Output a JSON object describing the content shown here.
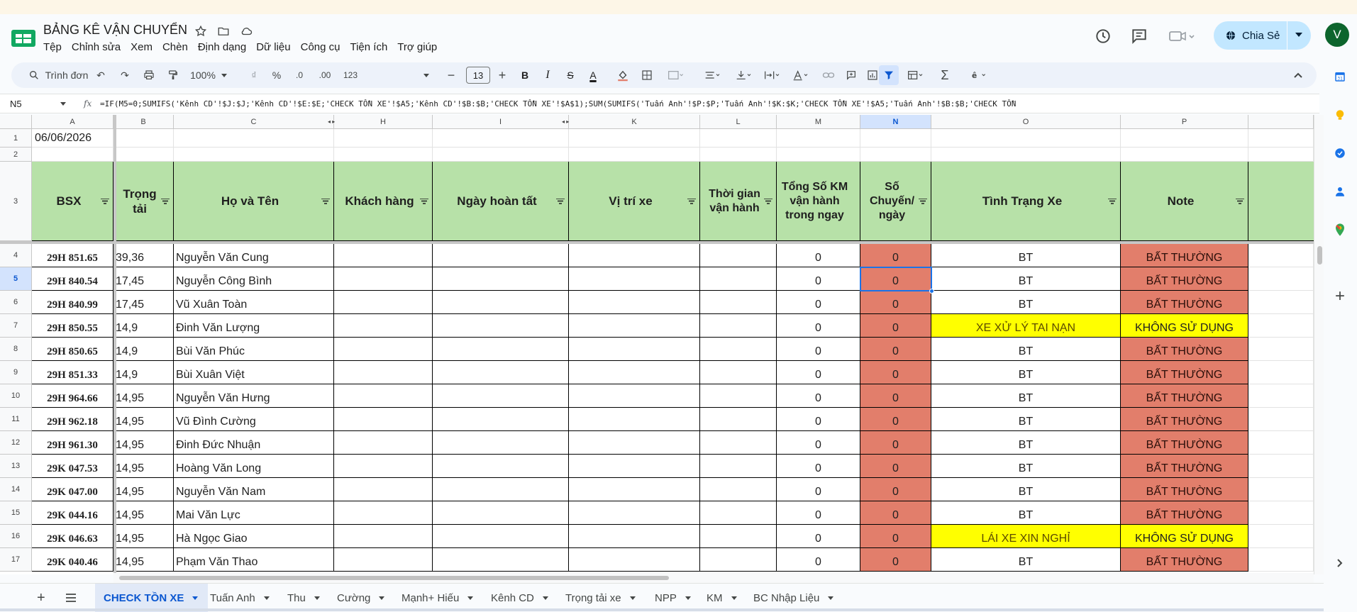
{
  "app": {
    "doc_title": "BẢNG KÊ VẬN CHUYỂN",
    "menu": [
      "Tệp",
      "Chỉnh sửa",
      "Xem",
      "Chèn",
      "Định dạng",
      "Dữ liệu",
      "Công cụ",
      "Tiện ích",
      "Trợ giúp"
    ],
    "share_label": "Chia Sẻ",
    "avatar_letter": "V"
  },
  "toolbar": {
    "search_label": "Trình đơn",
    "zoom": "100%",
    "currency": "₫",
    "percent": "%",
    "dec_less": ".0",
    "dec_more": ".00",
    "number_format": "123",
    "font_size": "13",
    "bold": "B",
    "italic": "I",
    "strike": "S",
    "text_color": "A",
    "sigma": "Σ"
  },
  "formula_bar": {
    "cell_ref": "N5",
    "fx": "fx",
    "formula": "=IF(M5=0;SUMIFS('Kênh CD'!$J:$J;'Kênh CD'!$E:$E;'CHECK TỒN XE'!$A5;'Kênh CD'!$B:$B;'CHECK TỒN XE'!$A$1);SUM(SUMIFS('Tuấn Anh'!$P:$P;'Tuấn Anh'!$K:$K;'CHECK TỒN XE'!$A5;'Tuấn Anh'!$B:$B;'CHECK TỒN"
  },
  "columns": [
    "A",
    "B",
    "C",
    "H",
    "I",
    "K",
    "L",
    "M",
    "N",
    "O",
    "P"
  ],
  "row_numbers": [
    "1",
    "2",
    "3",
    "4",
    "5",
    "6",
    "7",
    "8",
    "9",
    "10",
    "11",
    "12",
    "13",
    "14",
    "15",
    "16",
    "17"
  ],
  "date_cell": "06/06/2026",
  "headers": {
    "bsx": "BSX",
    "trong_tai": "Trọng tải",
    "ho_ten": "Họ và Tên",
    "khach_hang": "Khách hàng",
    "ngay_hoan_tat": "Ngày hoàn tất",
    "vi_tri_xe": "Vị trí xe",
    "thoi_gian": "Thời gian vận hành",
    "tong_km": "Tổng Số KM vận hành trong ngay",
    "so_chuyen": "Số Chuyến/ ngày",
    "tinh_trang": "Tình Trạng Xe",
    "note": "Note"
  },
  "rows": [
    {
      "bsx": "29H 851.65",
      "trong_tai": "39,36",
      "ten": "Nguyễn Văn Cung",
      "km": "0",
      "chuyen": "0",
      "tinh_trang": "BT",
      "note": "BẤT THƯỜNG"
    },
    {
      "bsx": "29H 840.54",
      "trong_tai": "17,45",
      "ten": "Nguyễn Công Bình",
      "km": "0",
      "chuyen": "0",
      "tinh_trang": "BT",
      "note": "BẤT THƯỜNG"
    },
    {
      "bsx": "29H 840.99",
      "trong_tai": "17,45",
      "ten": "Vũ Xuân Toàn",
      "km": "0",
      "chuyen": "0",
      "tinh_trang": "BT",
      "note": "BẤT THƯỜNG"
    },
    {
      "bsx": "29H 850.55",
      "trong_tai": "14,9",
      "ten": "Đinh Văn Lượng",
      "km": "0",
      "chuyen": "0",
      "tinh_trang": "XE XỬ LÝ TAI NẠN",
      "note": "KHÔNG SỬ DỤNG"
    },
    {
      "bsx": "29H 850.65",
      "trong_tai": "14,9",
      "ten": "Bùi Văn Phúc",
      "km": "0",
      "chuyen": "0",
      "tinh_trang": "BT",
      "note": "BẤT THƯỜNG"
    },
    {
      "bsx": "29H 851.33",
      "trong_tai": "14,9",
      "ten": "Bùi Xuân Việt",
      "km": "0",
      "chuyen": "0",
      "tinh_trang": "BT",
      "note": "BẤT THƯỜNG"
    },
    {
      "bsx": "29H 964.66",
      "trong_tai": "14,95",
      "ten": "Nguyễn Văn Hưng",
      "km": "0",
      "chuyen": "0",
      "tinh_trang": "BT",
      "note": "BẤT THƯỜNG"
    },
    {
      "bsx": "29H 962.18",
      "trong_tai": "14,95",
      "ten": "Vũ Đình Cường",
      "km": "0",
      "chuyen": "0",
      "tinh_trang": "BT",
      "note": "BẤT THƯỜNG"
    },
    {
      "bsx": "29H 961.30",
      "trong_tai": "14,95",
      "ten": "Đinh Đức Nhuận",
      "km": "0",
      "chuyen": "0",
      "tinh_trang": "BT",
      "note": "BẤT THƯỜNG"
    },
    {
      "bsx": "29K 047.53",
      "trong_tai": "14,95",
      "ten": "Hoàng Văn Long",
      "km": "0",
      "chuyen": "0",
      "tinh_trang": "BT",
      "note": "BẤT THƯỜNG"
    },
    {
      "bsx": "29K 047.00",
      "trong_tai": "14,95",
      "ten": "Nguyễn Văn Nam",
      "km": "0",
      "chuyen": "0",
      "tinh_trang": "BT",
      "note": "BẤT THƯỜNG"
    },
    {
      "bsx": "29K 044.16",
      "trong_tai": "14,95",
      "ten": "Mai Văn Lực",
      "km": "0",
      "chuyen": "0",
      "tinh_trang": "BT",
      "note": "BẤT THƯỜNG"
    },
    {
      "bsx": "29K 046.63",
      "trong_tai": "14,95",
      "ten": "Hà Ngọc Giao",
      "km": "0",
      "chuyen": "0",
      "tinh_trang": "LÁI XE XIN NGHỈ",
      "note": "KHÔNG SỬ DỤNG"
    },
    {
      "bsx": "29K 040.46",
      "trong_tai": "14,95",
      "ten": "Phạm Văn Thao",
      "km": "0",
      "chuyen": "0",
      "tinh_trang": "BT",
      "note": "BẤT THƯỜNG"
    }
  ],
  "sheet_tabs": [
    "CHECK TỒN XE",
    "Tuấn Anh",
    "Thu",
    "Cường",
    "Mạnh+ Hiếu",
    "Kênh CD",
    "Trọng tải xe",
    "NPP",
    "KM",
    "BC Nhập Liệu"
  ],
  "colors": {
    "header_green": "#b7e1a8",
    "abnormal_red": "#e27e6b",
    "highlight_yellow": "#ffff00",
    "accent_blue": "#0b57d0"
  }
}
